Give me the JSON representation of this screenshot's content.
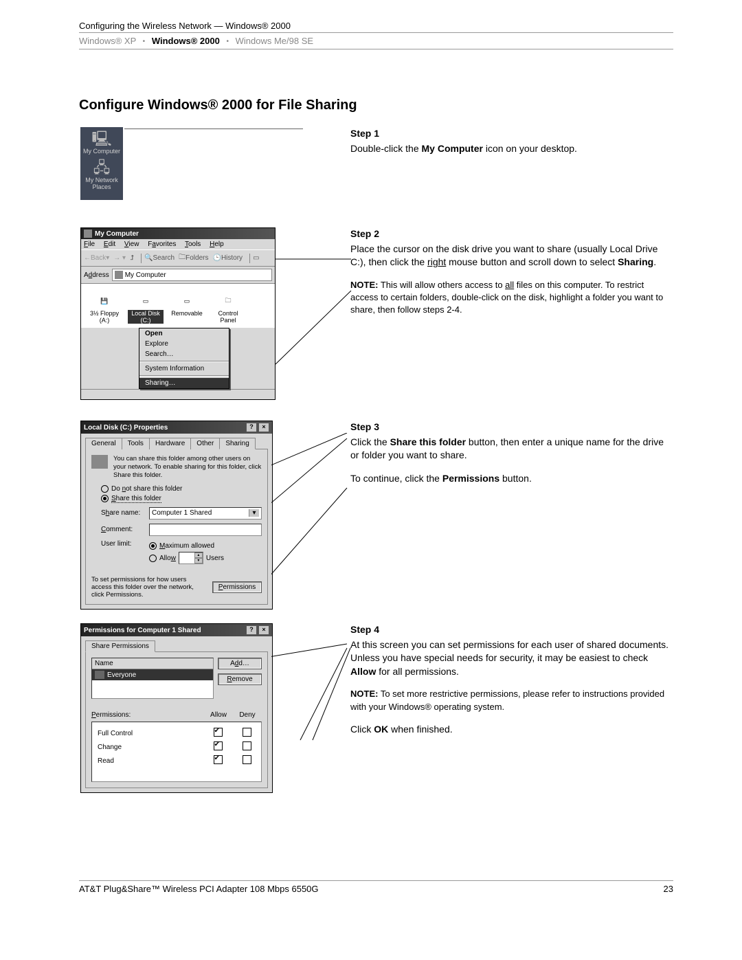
{
  "header": {
    "breadcrumb": "Configuring the Wireless Network — Windows® 2000",
    "nav": {
      "xp": "Windows® XP",
      "w2k": "Windows® 2000",
      "me98": "Windows Me/98 SE"
    }
  },
  "heading": "Configure Windows® 2000 for File Sharing",
  "desktop": {
    "my_computer": "My Computer",
    "my_network": "My Network Places"
  },
  "step1": {
    "title": "Step 1",
    "body_pre": "Double-click the ",
    "body_bold": "My Computer",
    "body_post": " icon on your desktop."
  },
  "explorer": {
    "title": "My Computer",
    "menu": {
      "file": "File",
      "edit": "Edit",
      "view": "View",
      "fav": "Favorites",
      "tools": "Tools",
      "help": "Help"
    },
    "tb": {
      "back": "Back",
      "search": "Search",
      "folders": "Folders",
      "history": "History"
    },
    "addr_label": "Address",
    "addr_value": "My Computer",
    "drives": {
      "floppy": "3½ Floppy (A:)",
      "local": "Local Disk (C:)",
      "removable": "Removable",
      "cpanel": "Control Panel"
    },
    "ctx": {
      "open": "Open",
      "explore": "Explore",
      "search": "Search…",
      "sysinfo": "System Information",
      "sharing": "Sharing…"
    }
  },
  "step2": {
    "title": "Step 2",
    "body_a": "Place the cursor on the disk drive you want to share (usually Local Drive C:), then click the ",
    "right": "right",
    "body_b": " mouse button and scroll down to select ",
    "sharing": "Sharing",
    "period": ".",
    "note_label": "NOTE:",
    "note_a": " This will allow others access to ",
    "all": "all",
    "note_b": " files on this computer. To restrict access to certain folders, double-click on the disk, highlight a folder you want to share, then follow steps 2-4."
  },
  "propdlg": {
    "title": "Local Disk (C:) Properties",
    "tabs": {
      "general": "General",
      "tools": "Tools",
      "hardware": "Hardware",
      "other": "Other",
      "sharing": "Sharing"
    },
    "info": "You can share this folder among other users on your network.  To enable sharing for this folder, click Share this folder.",
    "r1": "Do not share this folder",
    "r2": "Share this folder",
    "share_label": "Share name:",
    "share_value": "Computer 1 Shared",
    "comment_label": "Comment:",
    "limit_label": "User limit:",
    "r3": "Maximum allowed",
    "r4": "Allow",
    "users": "Users",
    "perm_note": "To set permissions for how users access this folder over the network, click Permissions.",
    "perm_btn": "Permissions"
  },
  "step3": {
    "title": "Step 3",
    "body_a1": "Click the ",
    "body_a2": "Share this folder",
    "body_a3": " button, then enter a unique name for the drive or folder you want to share.",
    "body_b1": "To continue, click the ",
    "body_b2": "Permissions",
    "body_b3": " button."
  },
  "permdlg": {
    "title": "Permissions for Computer 1 Shared",
    "tab": "Share Permissions",
    "name_col": "Name",
    "add_btn": "Add…",
    "remove_btn": "Remove",
    "everyone": "Everyone",
    "perm_label": "Permissions:",
    "allow": "Allow",
    "deny": "Deny",
    "rows": {
      "full": "Full Control",
      "change": "Change",
      "read": "Read"
    }
  },
  "step4": {
    "title": "Step 4",
    "body_a1": "At this screen you can set permissions for each user of shared documents. Unless you have special needs for security, it may be easiest to check ",
    "body_a2": "Allow",
    "body_a3": " for all permissions.",
    "note_label": "NOTE:",
    "note": " To set more restrictive permissions, please refer to instructions provided with your Windows® operating system.",
    "body_b1": "Click ",
    "body_b2": "OK",
    "body_b3": " when finished."
  },
  "footer": {
    "product": "AT&T Plug&Share™ Wireless PCI Adapter 108 Mbps 6550G",
    "page": "23"
  }
}
